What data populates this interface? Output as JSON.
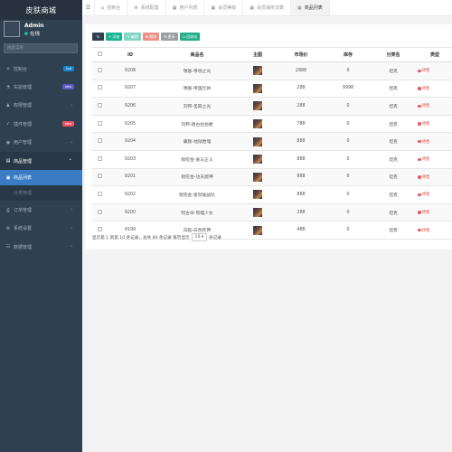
{
  "app": {
    "title": "皮肤商城"
  },
  "user": {
    "name": "Admin",
    "status": "在线"
  },
  "search": {
    "placeholder": "搜索菜单"
  },
  "colors": {
    "sidebar": "#2f4050",
    "accent": "#1ab394",
    "active_menu": "#3a7cc4",
    "danger": "#ed5565"
  },
  "sidebar": {
    "items": [
      {
        "label": "控制台",
        "icon": "home-icon",
        "badge": "hot",
        "badge_color": "#1c84c6"
      },
      {
        "label": "实验管理",
        "icon": "flask-icon",
        "badge": "new",
        "badge_color": "#5c5cc6"
      },
      {
        "label": "权限管理",
        "icon": "users-icon",
        "arrow": "‹"
      },
      {
        "label": "插件管理",
        "icon": "rocket-icon",
        "badge": "new",
        "badge_color": "#ed5565"
      },
      {
        "label": "用户管理",
        "icon": "user-circle-icon",
        "arrow": "‹"
      },
      {
        "label": "商品管理",
        "icon": "store-icon",
        "arrow": "⌄"
      },
      {
        "label": "商品列表",
        "icon": "list-icon"
      },
      {
        "label": "分类管理",
        "icon": ""
      },
      {
        "label": "订单管理",
        "icon": "print-icon",
        "arrow": "‹"
      },
      {
        "label": "系统设置",
        "icon": "cogs-icon",
        "arrow": "‹"
      },
      {
        "label": "数据管理",
        "icon": "database-icon",
        "arrow": "‹"
      }
    ]
  },
  "tabs": [
    {
      "label": "控制台",
      "icon": "home-icon"
    },
    {
      "label": "系统配置",
      "icon": "gear-icon"
    },
    {
      "label": "用户列表",
      "icon": "table-icon"
    },
    {
      "label": "会员等级",
      "icon": "table-icon"
    },
    {
      "label": "会员抽奖次数",
      "icon": "table-icon"
    },
    {
      "label": "商品列表",
      "icon": "table-icon"
    }
  ],
  "toolbar": {
    "add": "添加",
    "edit": "编辑",
    "delete": "删除",
    "detail": "更多",
    "export": "回收站"
  },
  "table": {
    "headers": [
      "",
      "ID",
      "商品名",
      "主图",
      "市场价",
      "库存",
      "分类名",
      "类型"
    ],
    "rows": [
      {
        "id": "9208",
        "name": "瑞恩-帝视之光",
        "price": "2888",
        "stock": "0",
        "category": "坦克",
        "status": "待售"
      },
      {
        "id": "9207",
        "name": "瑞恩-帝国元帅",
        "price": "288",
        "stock": "9998",
        "category": "坦克",
        "status": "待售"
      },
      {
        "id": "9206",
        "name": "刘邦-圣殿之光",
        "price": "288",
        "stock": "0",
        "category": "坦克",
        "status": "待售"
      },
      {
        "id": "9205",
        "name": "刘邦-德古拉伯爵",
        "price": "788",
        "stock": "0",
        "category": "坦克",
        "status": "待售"
      },
      {
        "id": "9204",
        "name": "廉颇-地狱岩魂",
        "price": "888",
        "stock": "0",
        "category": "坦克",
        "status": "待售"
      },
      {
        "id": "9203",
        "name": "程咬金-爱与正义",
        "price": "888",
        "stock": "0",
        "category": "坦克",
        "status": "待售"
      },
      {
        "id": "9201",
        "name": "程咬金-功夫厨神",
        "price": "888",
        "stock": "0",
        "category": "坦克",
        "status": "待售"
      },
      {
        "id": "9202",
        "name": "程咬金-星际陆战队",
        "price": "888",
        "stock": "0",
        "category": "坦克",
        "status": "待售"
      },
      {
        "id": "9200",
        "name": "阿古朵-熊喵少女",
        "price": "288",
        "stock": "0",
        "category": "坦克",
        "status": "待售"
      },
      {
        "id": "9199",
        "name": "白起-白色死神",
        "price": "488",
        "stock": "0",
        "category": "坦克",
        "status": "待售"
      }
    ]
  },
  "pagination": {
    "summary": "显示第 1 到第 10 条记录，总共 84 条记录 每页显示",
    "page_size": "10",
    "suffix": "条记录"
  }
}
